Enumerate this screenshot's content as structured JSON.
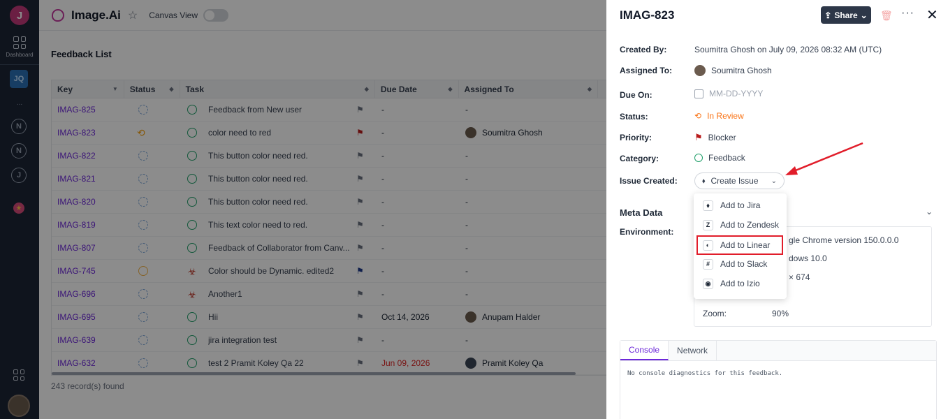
{
  "rail": {
    "logo": "J",
    "dashboard_label": "Dashboard",
    "workspace": "JQ",
    "dots": "...",
    "workspaces": [
      "N",
      "N",
      "J"
    ]
  },
  "header": {
    "project": "Image.Ai",
    "canvas_label": "Canvas View"
  },
  "feedback": {
    "title": "Feedback List",
    "columns": [
      "Key",
      "Status",
      "Task",
      "Due Date",
      "Assigned To"
    ],
    "rows": [
      {
        "key": "IMAG-825",
        "task": "Feedback from New user",
        "due": "-",
        "assignee": "-"
      },
      {
        "key": "IMAG-823",
        "task": "color need to red",
        "due": "-",
        "assignee": "Soumitra Ghosh"
      },
      {
        "key": "IMAG-822",
        "task": "This button color need red.",
        "due": "-",
        "assignee": "-"
      },
      {
        "key": "IMAG-821",
        "task": "This button color need red.",
        "due": "-",
        "assignee": "-"
      },
      {
        "key": "IMAG-820",
        "task": "This button color need red.",
        "due": "-",
        "assignee": "-"
      },
      {
        "key": "IMAG-819",
        "task": "This text color need to red.",
        "due": "-",
        "assignee": "-"
      },
      {
        "key": "IMAG-807",
        "task": "Feedback of Collaborator from Canv...",
        "due": "-",
        "assignee": "-"
      },
      {
        "key": "IMAG-745",
        "task": "Color should be Dynamic. edited2",
        "due": "-",
        "assignee": "-"
      },
      {
        "key": "IMAG-696",
        "task": "Another1",
        "due": "-",
        "assignee": "-"
      },
      {
        "key": "IMAG-695",
        "task": "Hii",
        "due": "Oct 14, 2026",
        "assignee": "Anupam Halder"
      },
      {
        "key": "IMAG-639",
        "task": "jira integration test",
        "due": "-",
        "assignee": "-"
      },
      {
        "key": "IMAG-632",
        "task": "test 2 Pramit Koley Qa 22",
        "due": "Jun 09, 2026",
        "assignee": "Pramit Koley Qa"
      }
    ],
    "records": "243 record(s) found"
  },
  "panel": {
    "title": "IMAG-823",
    "share": "Share",
    "labels": {
      "created_by": "Created By:",
      "assigned_to": "Assigned To:",
      "due_on": "Due On:",
      "status": "Status:",
      "priority": "Priority:",
      "category": "Category:",
      "issue_created": "Issue Created:"
    },
    "created_by": "Soumitra Ghosh on July 09, 2026 08:32 AM (UTC)",
    "assigned_to": "Soumitra Ghosh",
    "due_placeholder": "MM-DD-YYYY",
    "status": "In Review",
    "priority": "Blocker",
    "category": "Feedback",
    "create_issue": "Create Issue",
    "meta_title": "Meta Data",
    "environment_label": "Environment:",
    "env": {
      "browser": "gle Chrome version 150.0.0.0",
      "os": "dows 10.0",
      "screen": "× 674",
      "zoom_label": "Zoom:",
      "zoom": "90%"
    },
    "tabs": [
      "Console",
      "Network"
    ],
    "console_text": "No console diagnostics for this feedback."
  },
  "menu": {
    "items": [
      "Add to Jira",
      "Add to Zendesk",
      "Add to Linear",
      "Add to Slack",
      "Add to Izio"
    ]
  },
  "colors": {
    "accent": "#6d28d9",
    "highlight": "#e11d2a",
    "review": "#f97316"
  }
}
